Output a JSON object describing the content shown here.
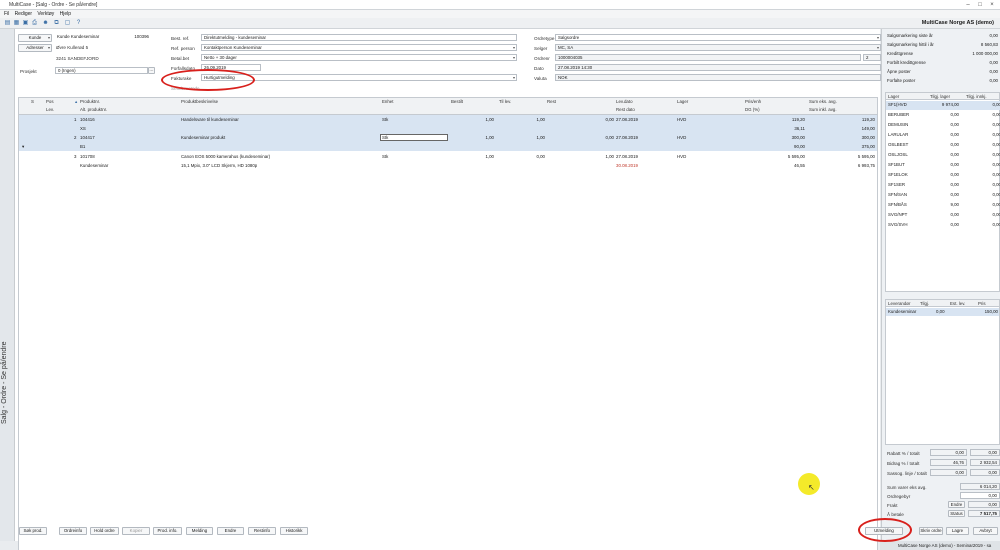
{
  "window": {
    "title": "MultiCase - [Salg - Ordre - Se på/endre]",
    "company": "MultiCase Norge AS (demo)"
  },
  "menu": [
    "Fil",
    "Rediger",
    "Verktøy",
    "Hjelp"
  ],
  "sidebar": {
    "label": "Salg - Ordre - Se på/endre"
  },
  "customer": {
    "kunde_btn": "Kunde",
    "kunde_name": "Kunde Kundeseminar",
    "kunde_no": "100396",
    "adresse_btn": "Adresser",
    "adresse1": "Øvre Kullerød 5",
    "adresse2": "3241 SANDEFJORD",
    "prosjekt_label": "Prosjekt",
    "prosjekt_value": "0 (Ingen)"
  },
  "refs": {
    "best_ref_label": "Best. ref.",
    "best_ref": "Direktutmelding - kundeseminar",
    "ref_person_label": "Ref. person",
    "ref_person": "Kontaktperson Kundeseminar",
    "betal_label": "Betal.bet",
    "betal": "Netto + 30 dager",
    "forfall_label": "Forfallsdato",
    "forfall": "26.09.2019",
    "fakturake_label": "Fakturake",
    "fakturake": "Hurtigutmelding",
    "cutoff": "Sendt.metode"
  },
  "order": {
    "ordretype_label": "Ordretype",
    "ordretype": "Salgsordre",
    "selger_label": "Selger",
    "selger": "MC, SA",
    "ordrenr_label": "Ordrenr",
    "ordrenr": "1000004035",
    "ordrenr_extra": "2",
    "dato_label": "Dato",
    "dato": "27.08.2019 14:30",
    "valuta_label": "Valuta",
    "valuta": "NOK"
  },
  "grid": {
    "headers_top": [
      "S",
      "Pos",
      "Produktnr.",
      "Produktbeskrivelse",
      "Enhet",
      "Bestilt",
      "Til lev.",
      "Rest",
      "Lev.dato",
      "Lager",
      "Pris/enh",
      "Sum eks. avg."
    ],
    "headers_bottom": [
      "Lev.",
      "Alt. produktnr.",
      "Rest dato",
      "DG (%)",
      "Sum inkl. avg."
    ],
    "rows": [
      {
        "top": {
          "pos": "1",
          "prodnr": "104416",
          "desc": "Handelsvare til kundeseminar",
          "enhet": "Stk",
          "bestilt": "1,00",
          "tillev": "1,00",
          "rest": "0,00",
          "levdato": "27.08.2019",
          "lager": "HVD",
          "pris": "119,20",
          "sum": "119,20"
        },
        "bottom": {
          "lev": "",
          "alt": "XS",
          "restdato": "",
          "dg": "36,11",
          "sumink": "149,00"
        }
      },
      {
        "top": {
          "pos": "2",
          "prodnr": "104417",
          "desc": "Kundeseminar produkt",
          "enhet": "Stk",
          "bestilt": "1,00",
          "tillev": "1,00",
          "rest": "0,00",
          "levdato": "27.08.2019",
          "lager": "HVD",
          "pris": "300,00",
          "sum": "300,00"
        },
        "bottom": {
          "lev": "▾",
          "alt": "B1",
          "restdato": "",
          "dg": "90,00",
          "sumink": "375,00"
        }
      },
      {
        "top": {
          "pos": "3",
          "prodnr": "101708",
          "desc": "Canon EOS 5000 kamerahus (kundeseminar)",
          "enhet": "Stk",
          "bestilt": "1,00",
          "tillev": "0,00",
          "rest": "1,00",
          "levdato": "27.08.2019",
          "lager": "HVD",
          "pris": "5 595,00",
          "sum": "5 595,00"
        },
        "bottom": {
          "lev": "",
          "alt": "Kundeseminar",
          "desc2": "15,1 Mpix, 3.0\" LCD Skjerm, HD 1080p",
          "restdato": "30.08.2019",
          "dg": "46,55",
          "sumink": "6 993,75"
        }
      }
    ]
  },
  "right_top": [
    {
      "label": "Salgsmarkering siste år",
      "value": "0,00"
    },
    {
      "label": "Salgsmarkering hittil i år",
      "value": "8 560,83"
    },
    {
      "label": "Kredittgrense",
      "value": "1 000 000,00"
    },
    {
      "label": "Forbilt kredittgrense",
      "value": "0,00"
    },
    {
      "label": "Åpne poster",
      "value": "0,00"
    },
    {
      "label": "Forfalte poster",
      "value": "0,00"
    }
  ],
  "lager_headers": [
    "Lager",
    "Tilgj. lager",
    "Tilgj. innkj."
  ],
  "lager": [
    {
      "name": "SF1(HVD",
      "a": "9 974,00",
      "b": "0,00"
    },
    {
      "name": "BERUBER",
      "a": "0,00",
      "b": "0,00"
    },
    {
      "name": "DEMUSIN",
      "a": "0,00",
      "b": "0,00"
    },
    {
      "name": "LARULAR",
      "a": "0,00",
      "b": "0,00"
    },
    {
      "name": "OSLBEST",
      "a": "0,00",
      "b": "0,00"
    },
    {
      "name": "OSLJOSL",
      "a": "0,00",
      "b": "0,00"
    },
    {
      "name": "SF1BUT",
      "a": "0,00",
      "b": "0,00"
    },
    {
      "name": "SF1ELOK",
      "a": "0,00",
      "b": "0,00"
    },
    {
      "name": "SF1SER",
      "a": "0,00",
      "b": "0,00"
    },
    {
      "name": "SFN/SAN",
      "a": "0,00",
      "b": "0,00"
    },
    {
      "name": "SFN/BÅS",
      "a": "9,00",
      "b": "0,00"
    },
    {
      "name": "SVG/NPT",
      "a": "0,00",
      "b": "0,00"
    },
    {
      "name": "SVG/SVH",
      "a": "0,00",
      "b": "0,00"
    }
  ],
  "lev_headers": [
    "Leverandør",
    "Tilgj.",
    "Est. lev.",
    "Pris"
  ],
  "lev": [
    {
      "name": "Kundeseminar",
      "tilgj": "0,00",
      "est": "",
      "pris": "150,00"
    }
  ],
  "totals": [
    {
      "label": "Rabatt % / totalt",
      "a": "0,00",
      "b": "0,00"
    },
    {
      "label": "Bidrag % / totalt",
      "a": "46,76",
      "b": "2 932,54"
    },
    {
      "label": "Sassog. linje / totalt",
      "a": "0,00",
      "b": "0,00"
    }
  ],
  "summary": {
    "sum_label": "Sum varer eks avg.",
    "sum": "6 014,20",
    "ordregebyr_label": "Ordregebyr",
    "ordregebyr": "0,00",
    "frakt_label": "Frakt",
    "frakt_btn": "Endre",
    "frakt": "0,00",
    "status_btn": "Status",
    "total": "7 517,75",
    "total_label": "Å betale"
  },
  "buttons": {
    "sok_prod": "Søk prod.",
    "ordreinfo": "Ordreinfo",
    "hold_ordre": "Hold ordre",
    "kopier": "Kopier",
    "prod_info": "Prod. info.",
    "melding": "Melding",
    "endre": "Endre",
    "restinfo": "Restinfo",
    "historikk": "Historikk",
    "utmelding": "Utmelding",
    "skriv_ordre": "Skriv ordre",
    "lagre": "Lagre",
    "avbryt": "Avbryt"
  },
  "status": "MultiCase Norge AS (demo) - Seminar2019 - sa"
}
